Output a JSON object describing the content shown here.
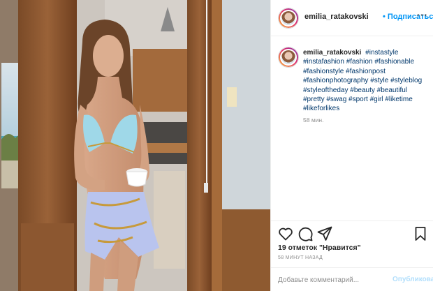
{
  "post": {
    "username": "emilia_ratakovski",
    "follow_separator": "•",
    "follow_label": "Подписаться",
    "more_label": "···",
    "caption_hashtags": [
      "#instastyle",
      "#instafashion",
      "#fashion",
      "#fashionable",
      "#fashionstyle",
      "#fashionpost",
      "#fashionphotography",
      "#style",
      "#styleblog",
      "#styleoftheday",
      "#beauty",
      "#beautiful",
      "#pretty",
      "#swag",
      "#sport",
      "#girl",
      "#liketime",
      "#likeforlikes"
    ],
    "caption_time": "58 мин.",
    "likes_text": "19 отметок \"Нравится\"",
    "posted_ago": "58 МИНУТ НАЗАД",
    "comment_placeholder": "Добавьте комментарий...",
    "publish_label": "Опубликовать"
  },
  "icons": {
    "like": "heart-icon",
    "comment": "comment-icon",
    "share": "paper-plane-icon",
    "save": "bookmark-icon"
  },
  "colors": {
    "accent_blue": "#0095f6",
    "hashtag_blue": "#00376b",
    "muted_gray": "#8e8e8e",
    "disabled_blue": "#b2dffc"
  }
}
